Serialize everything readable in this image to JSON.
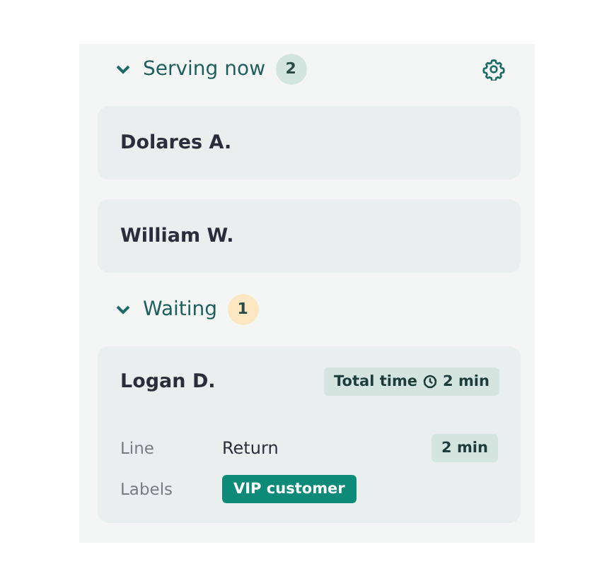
{
  "sections": [
    {
      "title": "Serving now",
      "count": "2",
      "color": "#d3e5df",
      "expanded": true,
      "settings": true,
      "customers": [
        {
          "name": "Dolares A."
        },
        {
          "name": "William W."
        }
      ]
    },
    {
      "title": "Waiting",
      "count": "1",
      "color": "#fbe7c2",
      "expanded": true,
      "settings": false,
      "customers": [
        {
          "name": "Logan D.",
          "total_label": "Total time",
          "total_time": "2 min",
          "details": [
            {
              "kind": "text",
              "label": "Line",
              "value": "Return",
              "time": "2 min"
            },
            {
              "kind": "tag",
              "label": "Labels",
              "value": "VIP customer"
            }
          ]
        }
      ]
    }
  ]
}
